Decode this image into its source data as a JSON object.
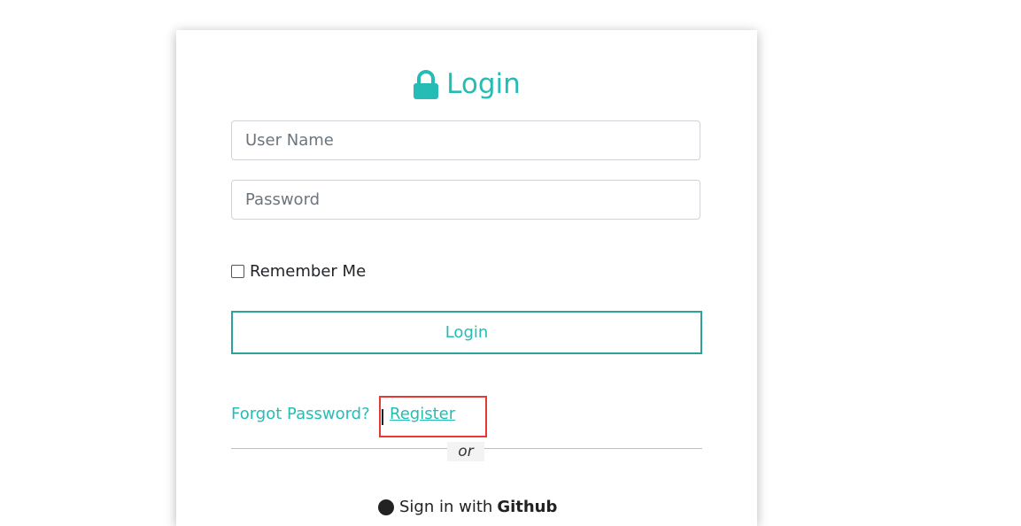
{
  "login_card": {
    "title": "Login",
    "title_icon": "lock-icon",
    "accent_color": "#26bcb6",
    "username": {
      "placeholder": "User Name",
      "value": ""
    },
    "password": {
      "placeholder": "Password",
      "value": ""
    },
    "remember_me": {
      "label": "Remember Me",
      "checked": false
    },
    "login_button": "Login",
    "forgot_password": "Forgot Password?",
    "register": "Register",
    "or_separator": "or",
    "github_signin": {
      "prefix": "Sign in with",
      "provider": "Github",
      "icon": "github-icon"
    }
  }
}
